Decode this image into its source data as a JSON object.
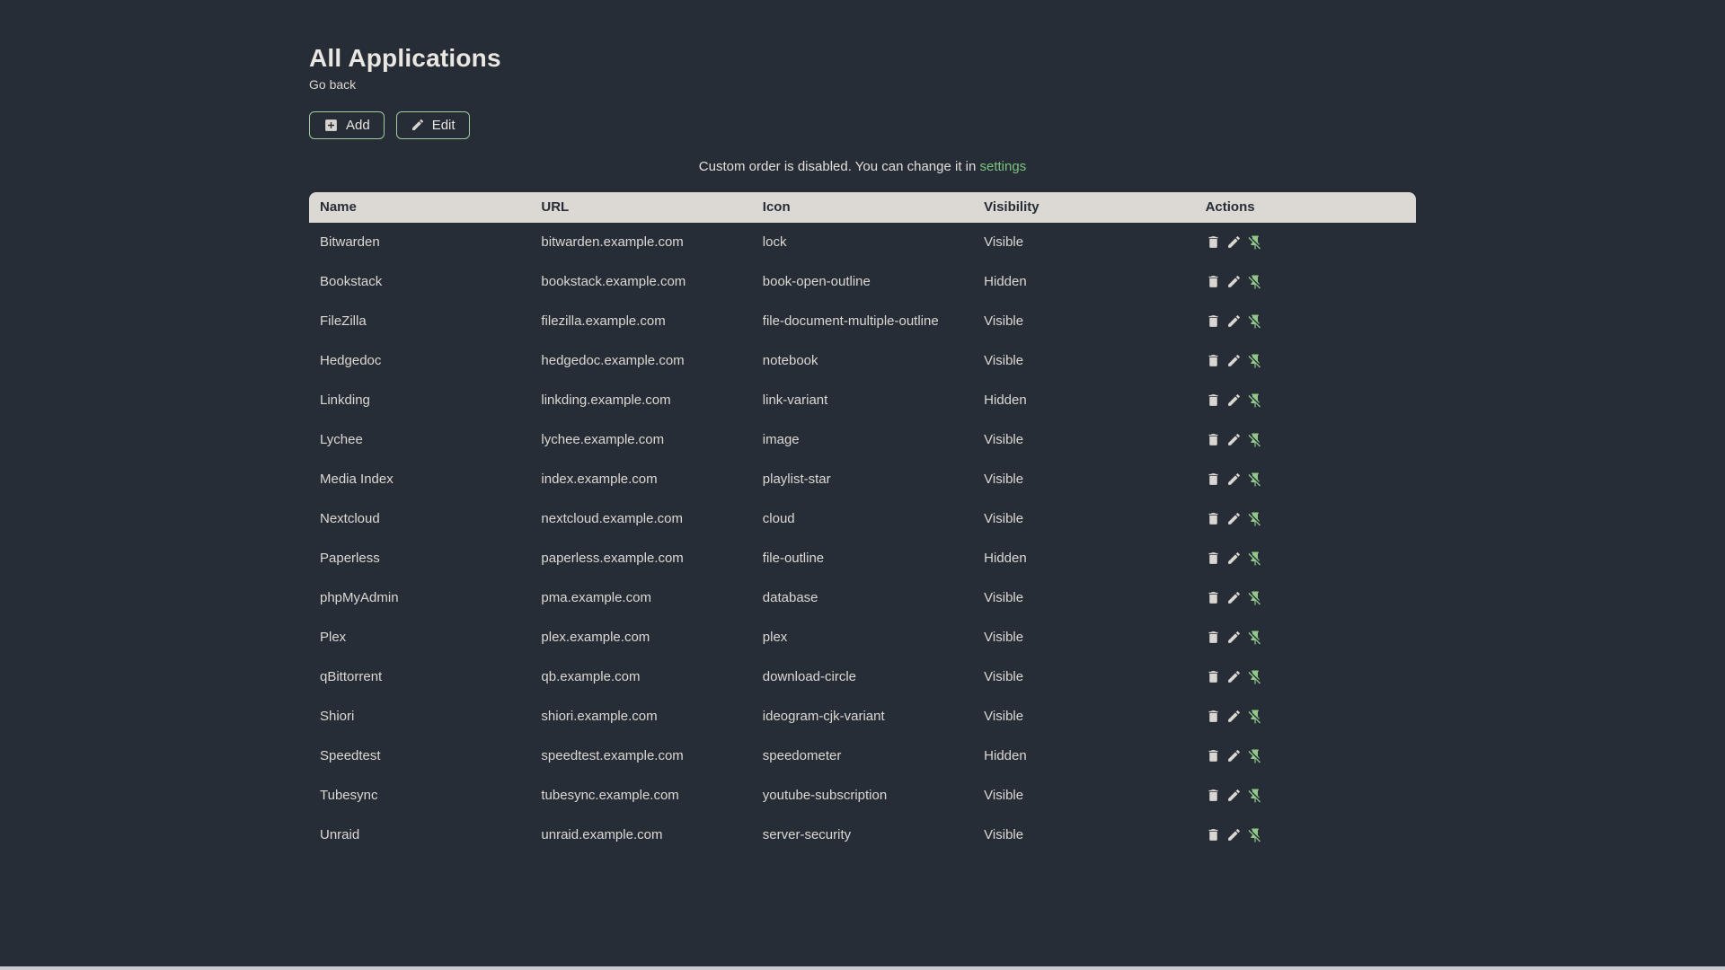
{
  "page": {
    "title": "All Applications",
    "go_back_label": "Go back",
    "notice": {
      "text_before_link": "Custom order is disabled. You can change it in ",
      "link_text": "settings"
    }
  },
  "toolbar": {
    "add_label": "Add",
    "edit_label": "Edit"
  },
  "table": {
    "headers": [
      "Name",
      "URL",
      "Icon",
      "Visibility",
      "Actions"
    ],
    "action_icons": [
      "delete-icon",
      "edit-icon",
      "pin-off-icon"
    ],
    "rows": [
      {
        "name": "Bitwarden",
        "url": "bitwarden.example.com",
        "icon": "lock",
        "visibility": "Visible"
      },
      {
        "name": "Bookstack",
        "url": "bookstack.example.com",
        "icon": "book-open-outline",
        "visibility": "Hidden"
      },
      {
        "name": "FileZilla",
        "url": "filezilla.example.com",
        "icon": "file-document-multiple-outline",
        "visibility": "Visible"
      },
      {
        "name": "Hedgedoc",
        "url": "hedgedoc.example.com",
        "icon": "notebook",
        "visibility": "Visible"
      },
      {
        "name": "Linkding",
        "url": "linkding.example.com",
        "icon": "link-variant",
        "visibility": "Hidden"
      },
      {
        "name": "Lychee",
        "url": "lychee.example.com",
        "icon": "image",
        "visibility": "Visible"
      },
      {
        "name": "Media Index",
        "url": "index.example.com",
        "icon": "playlist-star",
        "visibility": "Visible"
      },
      {
        "name": "Nextcloud",
        "url": "nextcloud.example.com",
        "icon": "cloud",
        "visibility": "Visible"
      },
      {
        "name": "Paperless",
        "url": "paperless.example.com",
        "icon": "file-outline",
        "visibility": "Hidden"
      },
      {
        "name": "phpMyAdmin",
        "url": "pma.example.com",
        "icon": "database",
        "visibility": "Visible"
      },
      {
        "name": "Plex",
        "url": "plex.example.com",
        "icon": "plex",
        "visibility": "Visible"
      },
      {
        "name": "qBittorrent",
        "url": "qb.example.com",
        "icon": "download-circle",
        "visibility": "Visible"
      },
      {
        "name": "Shiori",
        "url": "shiori.example.com",
        "icon": "ideogram-cjk-variant",
        "visibility": "Visible"
      },
      {
        "name": "Speedtest",
        "url": "speedtest.example.com",
        "icon": "speedometer",
        "visibility": "Hidden"
      },
      {
        "name": "Tubesync",
        "url": "tubesync.example.com",
        "icon": "youtube-subscription",
        "visibility": "Visible"
      },
      {
        "name": "Unraid",
        "url": "unraid.example.com",
        "icon": "server-security",
        "visibility": "Visible"
      }
    ]
  },
  "colors": {
    "background": "#272d36",
    "text_primary": "#dcd8d3",
    "title_text": "#eae7e3",
    "header_background": "#dcd8d3",
    "header_text": "#272d36",
    "accent_green_link": "#7cc47e",
    "button_border_green": "#a0cd9d",
    "pin_icon_green": "#93c78c",
    "action_icon_light": "#d9d5d0",
    "bottom_strip": "#c9cacd"
  }
}
